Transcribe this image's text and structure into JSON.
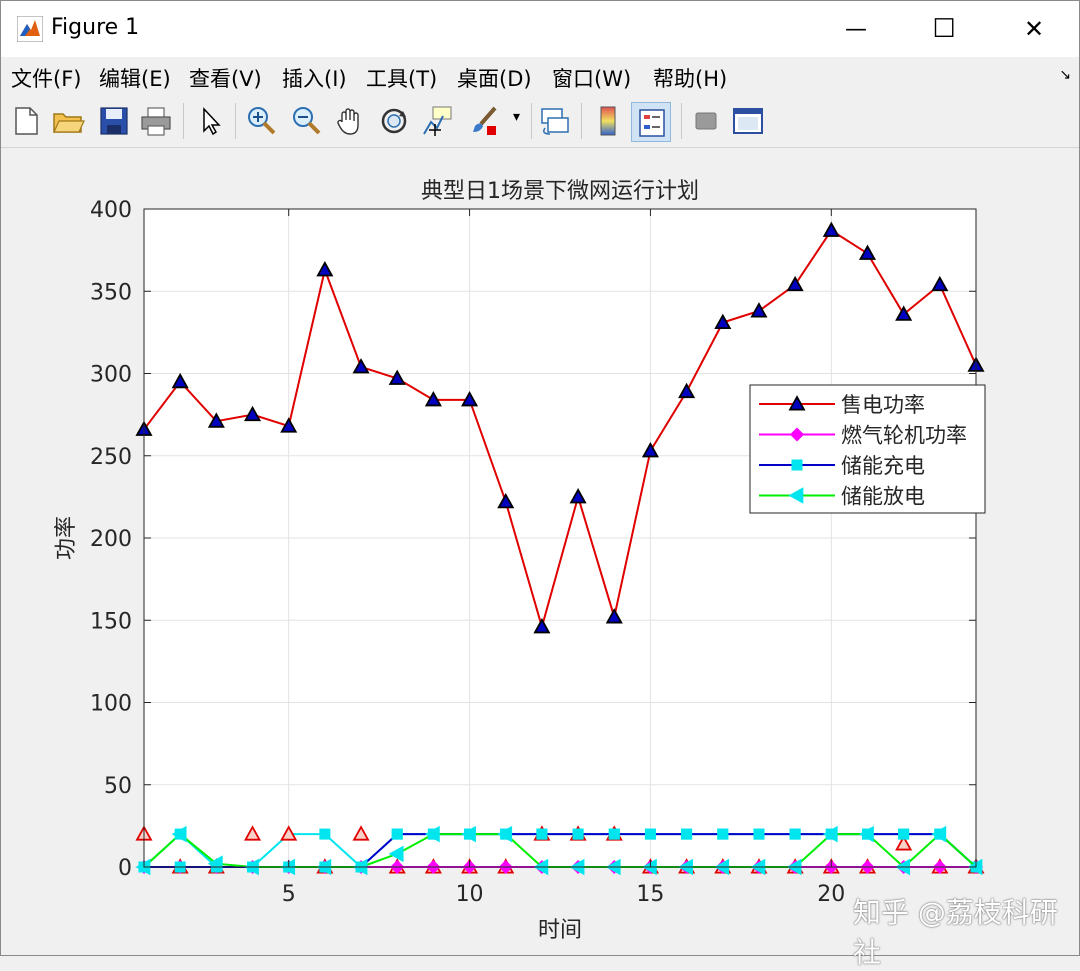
{
  "window": {
    "title": "Figure 1",
    "minimize_label": "—",
    "maximize_label": "☐",
    "close_label": "✕"
  },
  "menu": {
    "items": [
      "文件(F)",
      "编辑(E)",
      "查看(V)",
      "插入(I)",
      "工具(T)",
      "桌面(D)",
      "窗口(W)",
      "帮助(H)"
    ]
  },
  "toolbar": {
    "icons": [
      "new-file-icon",
      "open-folder-icon",
      "save-icon",
      "print-icon",
      "pointer-icon",
      "zoom-in-icon",
      "zoom-out-icon",
      "pan-hand-icon",
      "rotate-3d-icon",
      "data-cursor-icon",
      "brush-icon",
      "link-plot-icon",
      "colorbar-icon",
      "legend-icon",
      "hide-plot-tools-icon",
      "show-plot-tools-icon"
    ]
  },
  "colors": {
    "sell": "#e00000",
    "gas": "#ff00ff",
    "charge": "#0000c8",
    "discharge": "#00ee00",
    "marker_fill_blue": "#0000c0",
    "marker_fill_cyan": "#00e5ee"
  },
  "chart_data": {
    "type": "line",
    "title": "典型日1场景下微网运行计划",
    "xlabel": "时间",
    "ylabel": "功率",
    "xlim": [
      1,
      24
    ],
    "ylim": [
      0,
      400
    ],
    "xticks": [
      5,
      10,
      15,
      20
    ],
    "yticks": [
      0,
      50,
      100,
      150,
      200,
      250,
      300,
      350,
      400
    ],
    "grid": true,
    "legend_position": "right",
    "x": [
      1,
      2,
      3,
      4,
      5,
      6,
      7,
      8,
      9,
      10,
      11,
      12,
      13,
      14,
      15,
      16,
      17,
      18,
      19,
      20,
      21,
      22,
      23,
      24
    ],
    "series": [
      {
        "name": "售电功率",
        "color": "#e00000",
        "marker": "triangle-up",
        "values": [
          266,
          295,
          271,
          275,
          268,
          363,
          304,
          297,
          284,
          284,
          222,
          146,
          225,
          152,
          253,
          289,
          331,
          338,
          354,
          387,
          373,
          336,
          354,
          305
        ]
      },
      {
        "name": "燃气轮机功率",
        "color": "#ff00ff",
        "marker": "diamond",
        "values": [
          0,
          0,
          0,
          0,
          0,
          0,
          0,
          0,
          0,
          0,
          0,
          0,
          0,
          0,
          0,
          0,
          0,
          0,
          0,
          0,
          0,
          0,
          0,
          0
        ]
      },
      {
        "name": "储能充电",
        "color": "#0000c8",
        "marker": "square",
        "values": [
          0,
          0,
          0,
          0,
          0,
          0,
          0,
          20,
          20,
          20,
          20,
          20,
          20,
          20,
          20,
          20,
          20,
          20,
          20,
          20,
          20,
          20,
          20,
          0
        ]
      },
      {
        "name": "储能放电",
        "color": "#00ee00",
        "marker": "triangle-left",
        "values": [
          0,
          20,
          2,
          0,
          0,
          0,
          0,
          8,
          20,
          20,
          20,
          0,
          0,
          0,
          0,
          0,
          0,
          0,
          0,
          20,
          20,
          0,
          20,
          0
        ]
      }
    ],
    "extra_markers": {
      "description_hidden": "",
      "red_triangle_values": [
        20,
        0,
        0,
        20,
        20,
        0,
        20,
        0,
        0,
        0,
        0,
        20,
        20,
        20,
        0,
        0,
        0,
        0,
        0,
        0,
        0,
        14,
        0,
        0
      ],
      "cyan_line_values": [
        0,
        20,
        0,
        0,
        20,
        20,
        0,
        20,
        20,
        20,
        20,
        20,
        20,
        20,
        20,
        20,
        20,
        20,
        20,
        20,
        20,
        20,
        20,
        0
      ],
      "cyan_square_values": [
        0,
        20,
        0,
        0,
        0,
        20,
        0,
        20,
        20,
        20,
        20,
        20,
        20,
        20,
        20,
        20,
        20,
        20,
        20,
        20,
        20,
        20,
        20,
        0
      ]
    }
  },
  "watermark": "知乎 @荔枝科研社"
}
